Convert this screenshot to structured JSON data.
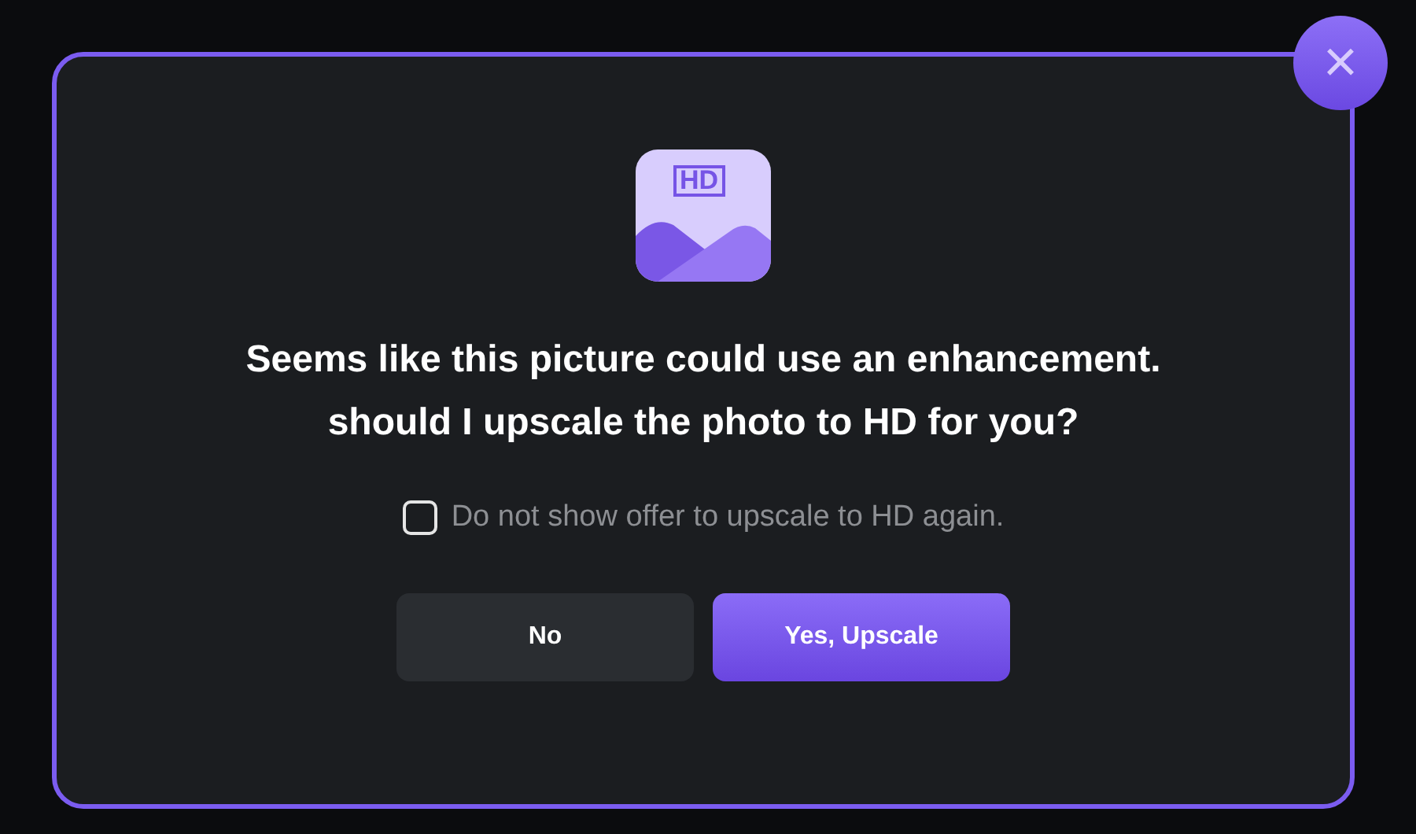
{
  "dialog": {
    "icon_label": "HD",
    "title_lines": [
      "Seems like this picture could use an enhancement.",
      "should I upscale the photo to HD for you?"
    ],
    "checkbox": {
      "label": "Do not show offer to upscale to HD again.",
      "checked": false
    },
    "buttons": [
      {
        "label": "No",
        "kind": "secondary"
      },
      {
        "label": "Yes, Upscale",
        "kind": "primary"
      }
    ],
    "close_button": {
      "label": "×"
    }
  }
}
